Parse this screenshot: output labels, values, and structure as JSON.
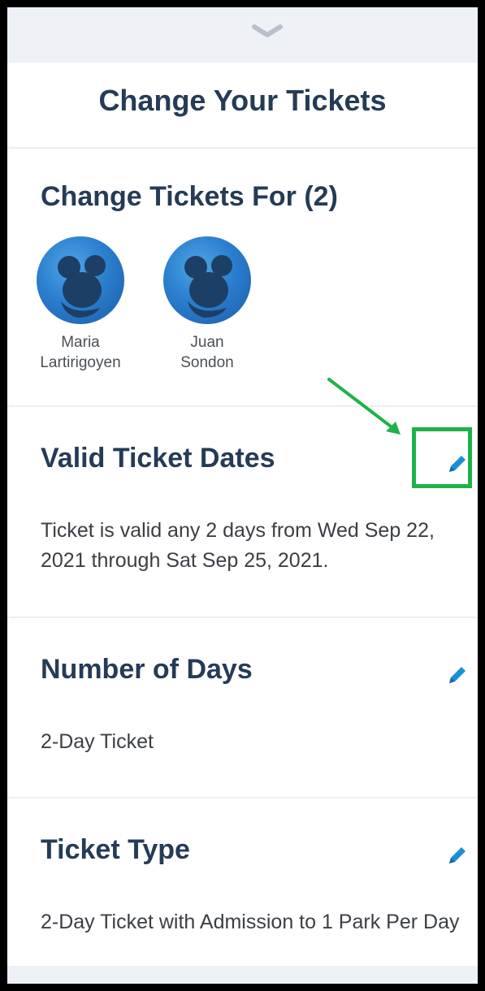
{
  "header": {
    "title": "Change Your Tickets"
  },
  "guests_section": {
    "title": "Change Tickets For (2)",
    "guests": [
      {
        "first_name": "Maria",
        "last_name": "Lartirigoyen"
      },
      {
        "first_name": "Juan",
        "last_name": "Sondon"
      }
    ]
  },
  "valid_dates_section": {
    "title": "Valid Ticket Dates",
    "description": "Ticket is valid any 2 days from Wed Sep 22, 2021 through Sat Sep 25, 2021."
  },
  "days_section": {
    "title": "Number of Days",
    "value": "2-Day Ticket"
  },
  "type_section": {
    "title": "Ticket Type",
    "value": "2-Day Ticket with Admission to 1 Park Per Day"
  },
  "icons": {
    "handle": "chevron-down-icon",
    "edit": "pencil-icon",
    "avatar": "mickey-silhouette-icon",
    "annotation_arrow": "arrow-icon"
  },
  "colors": {
    "title_text": "#253b56",
    "body_text": "#3b3f45",
    "edit_icon": "#1b8fd6",
    "highlight": "#1fb24a",
    "avatar_blue": "#2b7fcf",
    "handle_bar": "#eef1f5"
  }
}
